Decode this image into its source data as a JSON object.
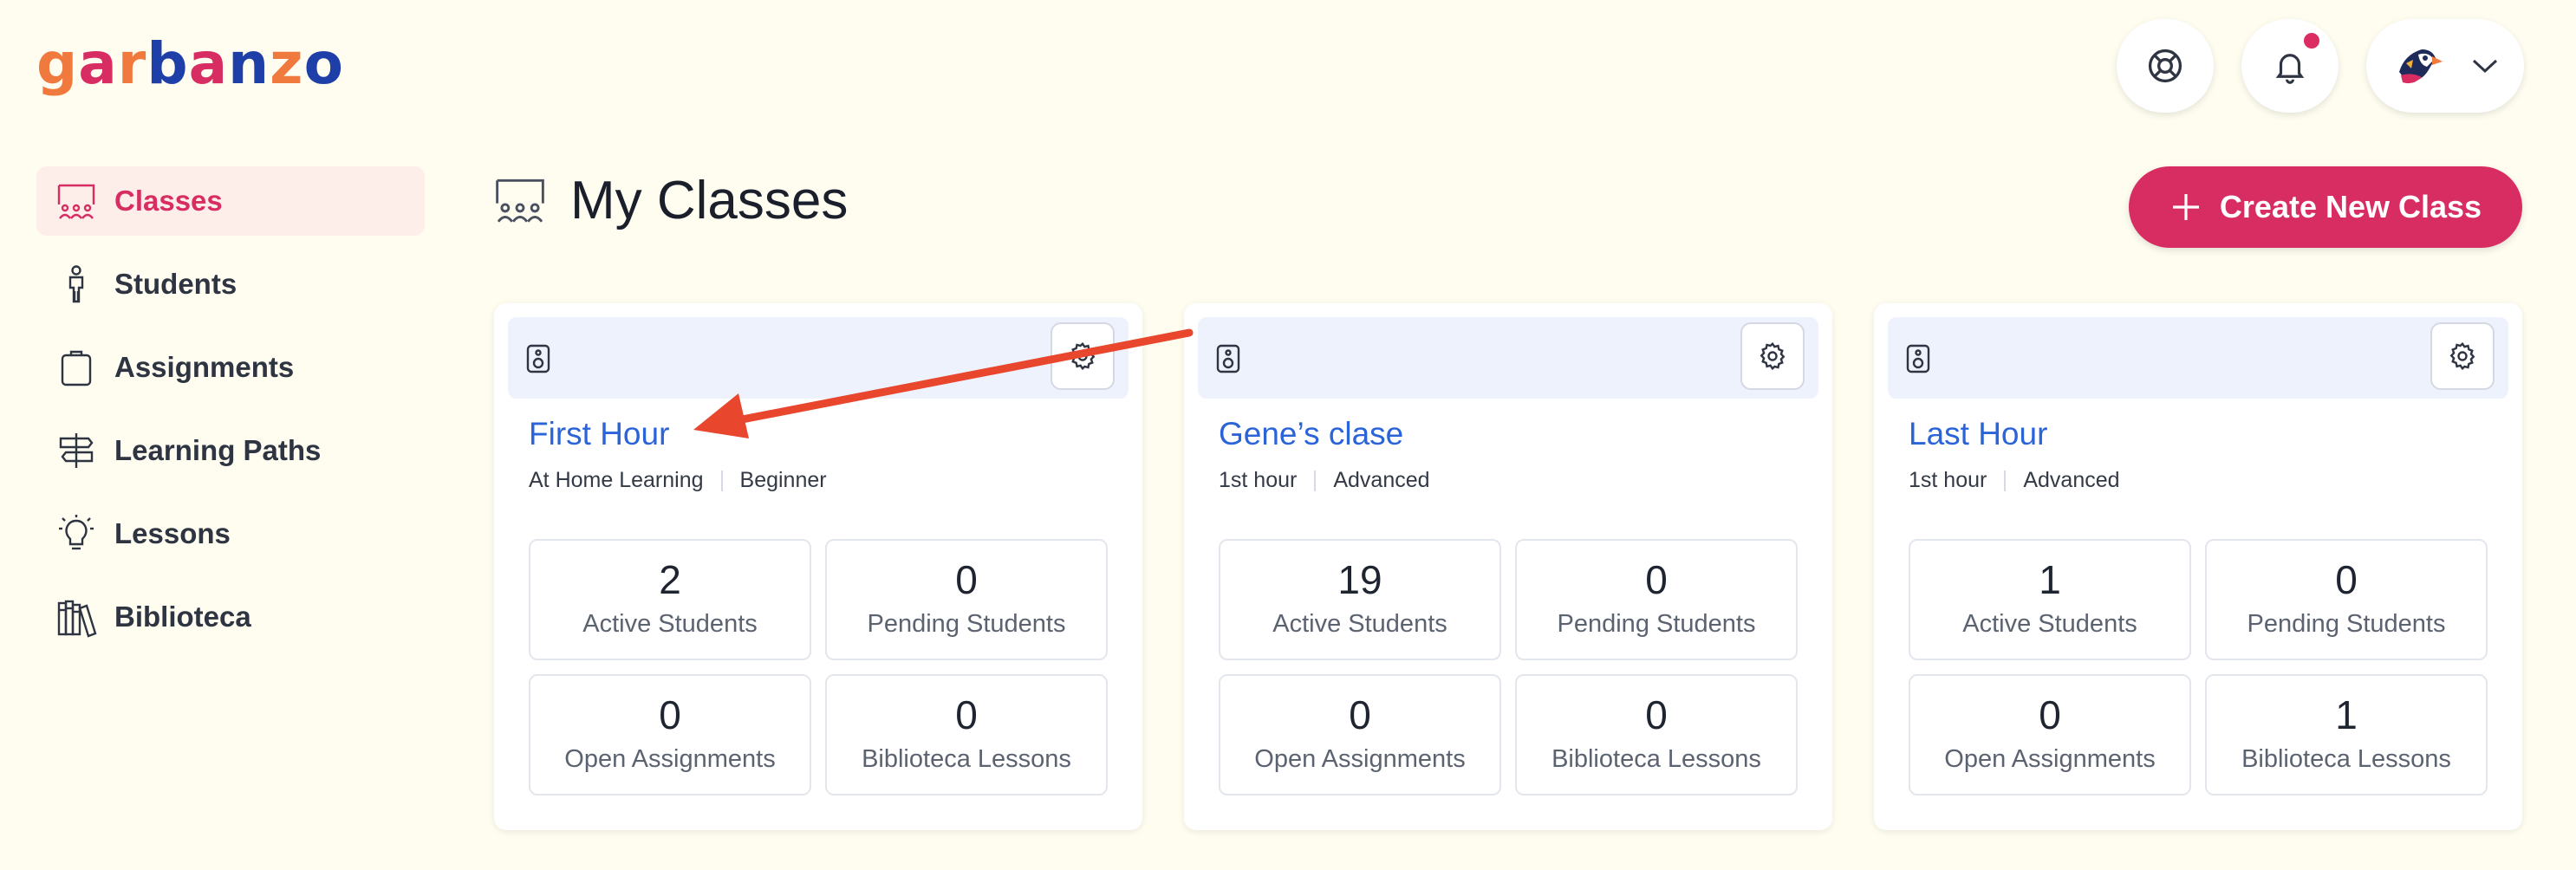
{
  "logo": {
    "text": "garbanzo",
    "colors": [
      "#f07a3e",
      "#d72d62",
      "#f07a3e",
      "#1f3fa8",
      "#d72d62",
      "#1f3fa8",
      "#f07a3e",
      "#1f3fa8"
    ]
  },
  "header": {
    "help_icon": "lifebuoy-icon",
    "notifications_icon": "bell-icon",
    "profile_icon": "puffin-avatar",
    "chevron": "chevron-down-icon"
  },
  "sidebar": {
    "items": [
      {
        "label": "Classes",
        "icon": "classroom-icon",
        "active": true
      },
      {
        "label": "Students",
        "icon": "student-icon",
        "active": false
      },
      {
        "label": "Assignments",
        "icon": "clipboard-icon",
        "active": false
      },
      {
        "label": "Learning Paths",
        "icon": "signpost-icon",
        "active": false
      },
      {
        "label": "Lessons",
        "icon": "lightbulb-icon",
        "active": false
      },
      {
        "label": "Biblioteca",
        "icon": "books-icon",
        "active": false
      }
    ]
  },
  "page": {
    "title": "My Classes",
    "create_label": "Create New Class"
  },
  "classes": [
    {
      "title": "First Hour",
      "meta1": "At Home Learning",
      "meta2": "Beginner",
      "stats": [
        {
          "value": "2",
          "label": "Active Students"
        },
        {
          "value": "0",
          "label": "Pending Students"
        },
        {
          "value": "0",
          "label": "Open Assignments"
        },
        {
          "value": "0",
          "label": "Biblioteca Lessons"
        }
      ]
    },
    {
      "title": "Gene’s clase",
      "meta1": "1st hour",
      "meta2": "Advanced",
      "stats": [
        {
          "value": "19",
          "label": "Active Students"
        },
        {
          "value": "0",
          "label": "Pending Students"
        },
        {
          "value": "0",
          "label": "Open Assignments"
        },
        {
          "value": "0",
          "label": "Biblioteca Lessons"
        }
      ]
    },
    {
      "title": "Last Hour",
      "meta1": "1st hour",
      "meta2": "Advanced",
      "stats": [
        {
          "value": "1",
          "label": "Active Students"
        },
        {
          "value": "0",
          "label": "Pending Students"
        },
        {
          "value": "0",
          "label": "Open Assignments"
        },
        {
          "value": "1",
          "label": "Biblioteca Lessons"
        }
      ]
    }
  ],
  "theme": {
    "accent": "#d72d62",
    "link": "#2a64d8",
    "background": "#fefdf0",
    "annotation_arrow": "#e8462d"
  }
}
